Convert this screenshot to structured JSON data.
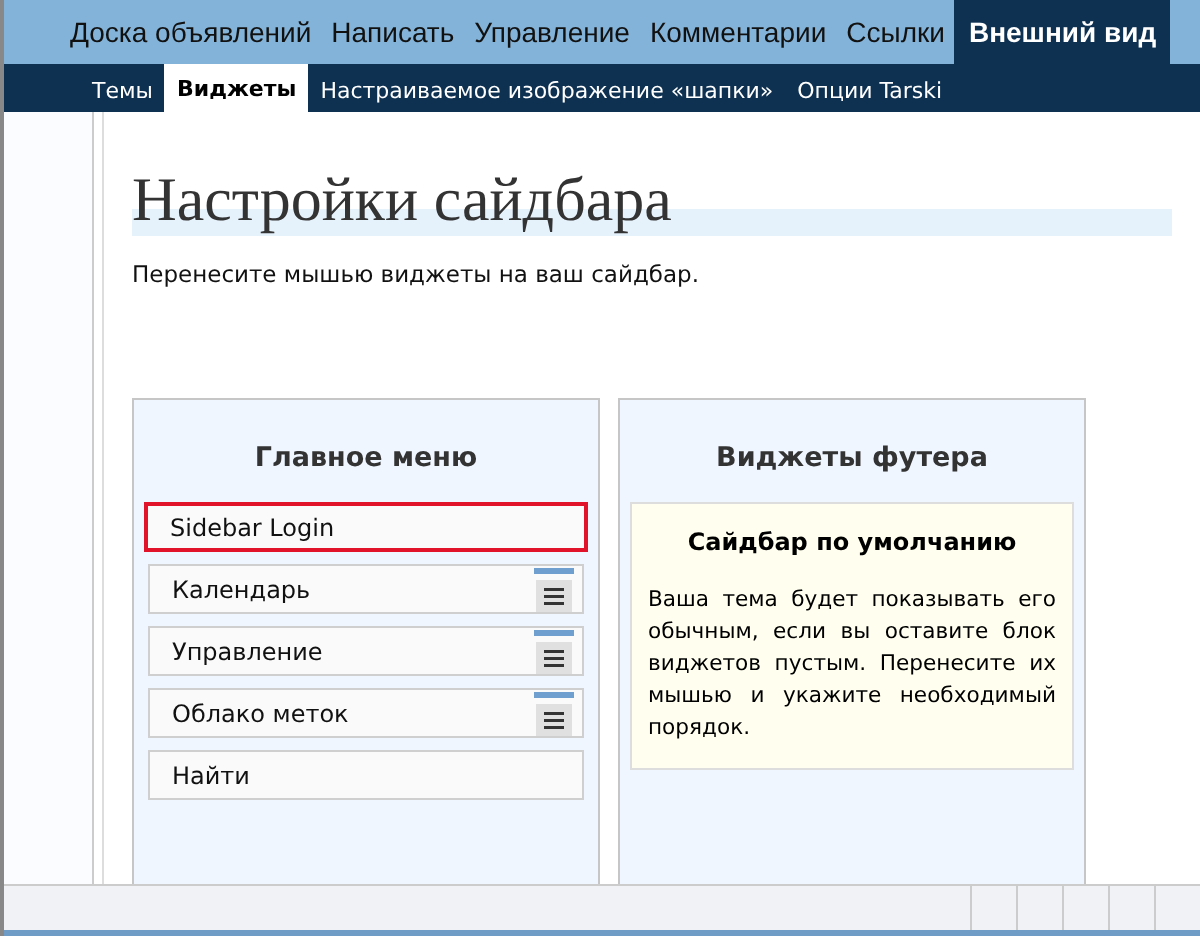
{
  "main_menu": [
    {
      "label": "Доска объявлений",
      "selected": false
    },
    {
      "label": "Написать",
      "selected": false
    },
    {
      "label": "Управление",
      "selected": false
    },
    {
      "label": "Комментарии",
      "selected": false
    },
    {
      "label": "Ссылки",
      "selected": false
    },
    {
      "label": "Внешний вид",
      "selected": true
    }
  ],
  "sub_menu": [
    {
      "label": "Темы",
      "selected": false
    },
    {
      "label": "Виджеты",
      "selected": true
    },
    {
      "label": "Настраиваемое изображение «шапки»",
      "selected": false
    },
    {
      "label": "Опции Tarski",
      "selected": false
    }
  ],
  "page_title": "Настройки сайдбара",
  "instructions": "Перенесите мышью виджеты на ваш сайдбар.",
  "sidebars": [
    {
      "title": "Главное меню",
      "widgets": [
        {
          "label": "Sidebar Login",
          "selected": true,
          "handle": false
        },
        {
          "label": "Календарь",
          "selected": false,
          "handle": true
        },
        {
          "label": "Управление",
          "selected": false,
          "handle": true
        },
        {
          "label": "Облако меток",
          "selected": false,
          "handle": true
        },
        {
          "label": "Найти",
          "selected": false,
          "handle": false
        }
      ]
    },
    {
      "title": "Виджеты футера",
      "notice": {
        "title": "Сайдбар по умолчанию",
        "text": "Ваша тема будет показывать его обычным, если вы оставите блок виджетов пустым. Перенесите их мышью и укажите необходимый порядок."
      }
    }
  ]
}
